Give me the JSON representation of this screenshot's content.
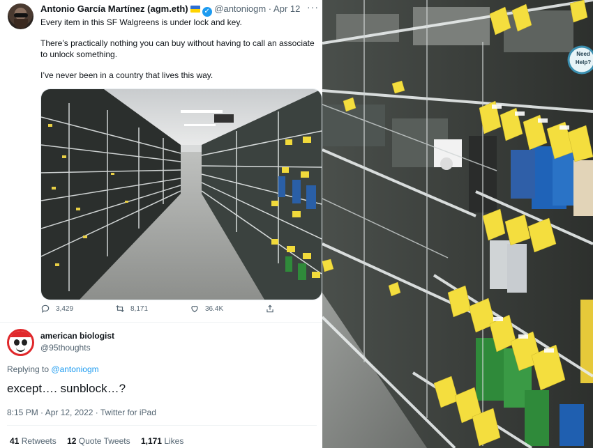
{
  "tweet": {
    "author_name": "Antonio García Martínez (agm.eth)",
    "handle": "@antoniogm",
    "separator": "·",
    "date": "Apr 12",
    "more": "···",
    "paragraphs": [
      "Every item in this SF Walgreens is under lock and key.",
      "There’s practically nothing you can buy without having to call an associate to unlock something.",
      "I’ve never been in a country that lives this way."
    ],
    "metrics": {
      "replies": "3,429",
      "retweets": "8,171",
      "likes": "36.4K"
    }
  },
  "reply": {
    "author_name": "american biologist",
    "handle": "@95thoughts",
    "replying_prefix": "Replying to",
    "replying_to": "@antoniogm",
    "text": "except…. sunblock…?",
    "meta": "8:15 PM · Apr 12, 2022 · Twitter for iPad",
    "stats": {
      "retweets_count": "41",
      "retweets_label": "Retweets",
      "quotes_count": "12",
      "quotes_label": "Quote Tweets",
      "likes_count": "1,171",
      "likes_label": "Likes"
    }
  },
  "photo_large": {
    "help_sign": [
      "Need",
      "Help?"
    ]
  },
  "icons": {
    "reply": "reply-icon",
    "retweet": "retweet-icon",
    "like": "like-icon",
    "share": "share-icon",
    "verified": "verified-icon",
    "flag": "ukraine-flag-icon"
  },
  "colors": {
    "accent": "#1d9bf0",
    "secondary_text": "#536471",
    "price_tag": "#f4de3e",
    "reply_avatar_ring": "#e0282b"
  }
}
